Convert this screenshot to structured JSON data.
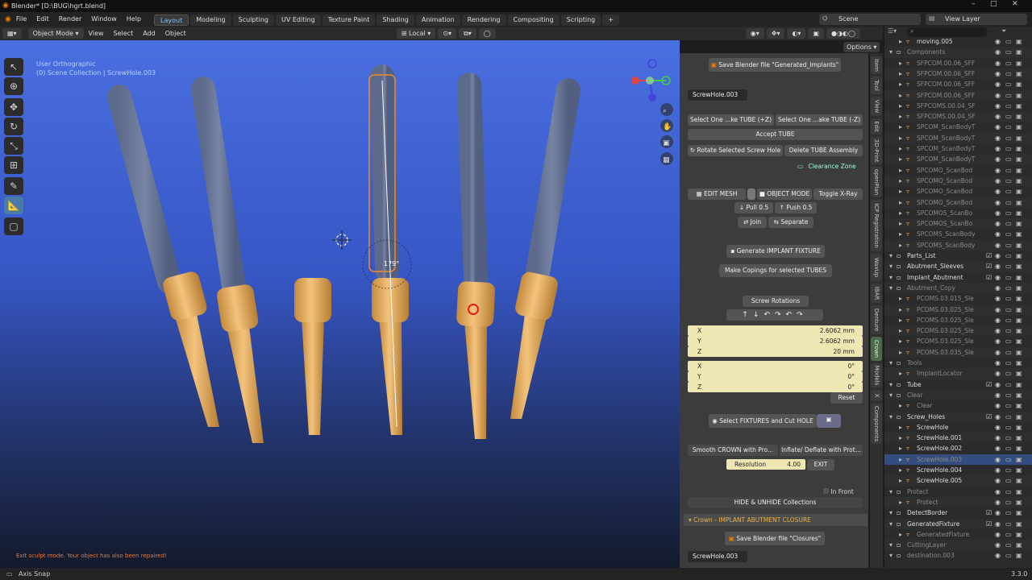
{
  "window": {
    "title": "Blender* [D:\\BUG\\hgrt.blend]",
    "controls": [
      "–",
      "□",
      "✕"
    ]
  },
  "menu": [
    "File",
    "Edit",
    "Render",
    "Window",
    "Help"
  ],
  "workspaces": [
    "Layout",
    "Modeling",
    "Sculpting",
    "UV Editing",
    "Texture Paint",
    "Shading",
    "Animation",
    "Rendering",
    "Compositing",
    "Scripting",
    "+"
  ],
  "scene": {
    "label": "Scene",
    "view_layer": "View Layer"
  },
  "header": {
    "mode": "Object Mode",
    "view": "View",
    "select": "Select",
    "add": "Add",
    "object": "Object",
    "orientation": "Local",
    "options": "Options"
  },
  "viewport": {
    "line1": "User Orthographic",
    "line2": "(0) Scene Collection | ScrewHole.003",
    "rotation": "179°",
    "message": "Exit sculpt mode. Your object has also been repaired!"
  },
  "panel": {
    "save_generated": "Save Blender file \"Generated_Implants\"",
    "active_name": "ScrewHole.003",
    "select_plus": "Select One ...ke TUBE (+Z)",
    "select_minus": "Select One ...ake TUBE (-Z)",
    "accept": "Accept TUBE",
    "rotate": "Rotate Selected Screw Hole",
    "delete": "Delete TUBE Assembly",
    "clearance": "Clearance Zone",
    "edit_mesh": "EDIT MESH",
    "object_mode": "OBJECT MODE",
    "xray": "Toggle X-Ray",
    "pull": "Pull 0.5",
    "push": "Push 0.5",
    "join": "Join",
    "separate": "Separate",
    "generate": "Generate IMPLANT FIXTURE",
    "copings": "Make Copings for selected TUBES",
    "screw_rot": "Screw Rotations",
    "loc": [
      {
        "axis": "X",
        "value": "2.6062 mm"
      },
      {
        "axis": "Y",
        "value": "2.6062 mm"
      },
      {
        "axis": "Z",
        "value": "20 mm"
      }
    ],
    "rot": [
      {
        "axis": "X",
        "value": "0°"
      },
      {
        "axis": "Y",
        "value": "0°"
      },
      {
        "axis": "Z",
        "value": "0°"
      }
    ],
    "reset": "Reset",
    "select_fixtures": "Select FIXTURES and Cut HOLE",
    "smooth": "Smooth CROWN with Pro...",
    "inflate": "Inflate/ Deflate with Prot...",
    "resolution_label": "Resolution",
    "resolution_value": "4.00",
    "exit": "EXIT",
    "in_front": "In Front",
    "hide_unhide": "HIDE & UNHIDE Collections",
    "section_crown": "Crown - IMPLANT  ABUTMENT CLOSURE",
    "save_closures": "Save Blender file \"Closures\"",
    "bottom_name": "ScrewHole.003"
  },
  "side_tabs": [
    "Item",
    "Tool",
    "View",
    "Edit",
    "3D-Print",
    "openPlan",
    "ICP Registration",
    "WaxUp",
    "IBAR",
    "Denture",
    "Crown",
    "Models",
    "X",
    "Components"
  ],
  "outliner": [
    {
      "n": "moving.005",
      "d": 2,
      "dim": false,
      "cb": false
    },
    {
      "n": "Components",
      "d": 1,
      "dim": true,
      "cb": false
    },
    {
      "n": "SFPCOM.00.06_SFF",
      "d": 2,
      "dim": true,
      "cb": false
    },
    {
      "n": "SFPCOM.00.06_SFF",
      "d": 2,
      "dim": true,
      "cb": false
    },
    {
      "n": "SFPCOM.00.06_SFF",
      "d": 2,
      "dim": true,
      "cb": false
    },
    {
      "n": "SFPCOM.00.06_SFF",
      "d": 2,
      "dim": true,
      "cb": false
    },
    {
      "n": "SFPCOMS.00.04_SF",
      "d": 2,
      "dim": true,
      "cb": false
    },
    {
      "n": "SFPCOMS.00.04_SF",
      "d": 2,
      "dim": true,
      "cb": false
    },
    {
      "n": "SPCOM_ScanBodyT",
      "d": 2,
      "dim": true,
      "cb": false
    },
    {
      "n": "SPCOM_ScanBodyT",
      "d": 2,
      "dim": true,
      "cb": false
    },
    {
      "n": "SPCOM_ScanBodyT",
      "d": 2,
      "dim": true,
      "cb": false
    },
    {
      "n": "SPCOM_ScanBodyT",
      "d": 2,
      "dim": true,
      "cb": false
    },
    {
      "n": "SPCOMO_ScanBod",
      "d": 2,
      "dim": true,
      "cb": false
    },
    {
      "n": "SPCOMO_ScanBod",
      "d": 2,
      "dim": true,
      "cb": false
    },
    {
      "n": "SPCOMO_ScanBod",
      "d": 2,
      "dim": true,
      "cb": false
    },
    {
      "n": "SPCOMO_ScanBod",
      "d": 2,
      "dim": true,
      "cb": false
    },
    {
      "n": "SPCOMOS_ScanBo",
      "d": 2,
      "dim": true,
      "cb": false
    },
    {
      "n": "SPCOMOS_ScanBo",
      "d": 2,
      "dim": true,
      "cb": false
    },
    {
      "n": "SPCOMS_ScanBody",
      "d": 2,
      "dim": true,
      "cb": false
    },
    {
      "n": "SPCOMS_ScanBody",
      "d": 2,
      "dim": true,
      "cb": false
    },
    {
      "n": "Parts_List",
      "d": 1,
      "dim": false,
      "cb": true
    },
    {
      "n": "Abutment_Sleeves",
      "d": 1,
      "dim": false,
      "cb": true
    },
    {
      "n": "Implant_Abutment",
      "d": 1,
      "dim": false,
      "cb": true
    },
    {
      "n": "Abutment_Copy",
      "d": 1,
      "dim": true,
      "cb": false
    },
    {
      "n": "PCOMS.03.015_Sle",
      "d": 2,
      "dim": true,
      "cb": false
    },
    {
      "n": "PCOMS.03.025_Sle",
      "d": 2,
      "dim": true,
      "cb": false
    },
    {
      "n": "PCOMS.03.025_Sle",
      "d": 2,
      "dim": true,
      "cb": false
    },
    {
      "n": "PCOMS.03.025_Sle",
      "d": 2,
      "dim": true,
      "cb": false
    },
    {
      "n": "PCOMS.03.025_Sle",
      "d": 2,
      "dim": true,
      "cb": false
    },
    {
      "n": "PCOMS.03.035_Sle",
      "d": 2,
      "dim": true,
      "cb": false
    },
    {
      "n": "Tools",
      "d": 1,
      "dim": true,
      "cb": false
    },
    {
      "n": "ImplantLocator",
      "d": 2,
      "dim": true,
      "cb": false
    },
    {
      "n": "Tube",
      "d": 1,
      "dim": false,
      "cb": true
    },
    {
      "n": "Clear",
      "d": 1,
      "dim": true,
      "cb": false
    },
    {
      "n": "Clear",
      "d": 2,
      "dim": true,
      "cb": false
    },
    {
      "n": "Screw_Holes",
      "d": 1,
      "dim": false,
      "cb": true
    },
    {
      "n": "ScrewHole",
      "d": 2,
      "dim": false,
      "cb": false
    },
    {
      "n": "ScrewHole.001",
      "d": 2,
      "dim": false,
      "cb": false
    },
    {
      "n": "ScrewHole.002",
      "d": 2,
      "dim": false,
      "cb": false
    },
    {
      "n": "ScrewHole.003",
      "d": 2,
      "dim": true,
      "cb": false,
      "sel": true
    },
    {
      "n": "ScrewHole.004",
      "d": 2,
      "dim": false,
      "cb": false
    },
    {
      "n": "ScrewHole.005",
      "d": 2,
      "dim": false,
      "cb": false
    },
    {
      "n": "Protect",
      "d": 1,
      "dim": true,
      "cb": false
    },
    {
      "n": "Protect",
      "d": 2,
      "dim": true,
      "cb": false
    },
    {
      "n": "DetectBorder",
      "d": 1,
      "dim": false,
      "cb": true
    },
    {
      "n": "GeneratedFixture",
      "d": 1,
      "dim": false,
      "cb": true
    },
    {
      "n": "GeneratedFixture",
      "d": 2,
      "dim": true,
      "cb": false
    },
    {
      "n": "CuttingLayer",
      "d": 1,
      "dim": true,
      "cb": false
    },
    {
      "n": "destination.003",
      "d": 1,
      "dim": true,
      "cb": false
    }
  ],
  "status": {
    "left": "Axis Snap",
    "version": "3.3.0"
  }
}
